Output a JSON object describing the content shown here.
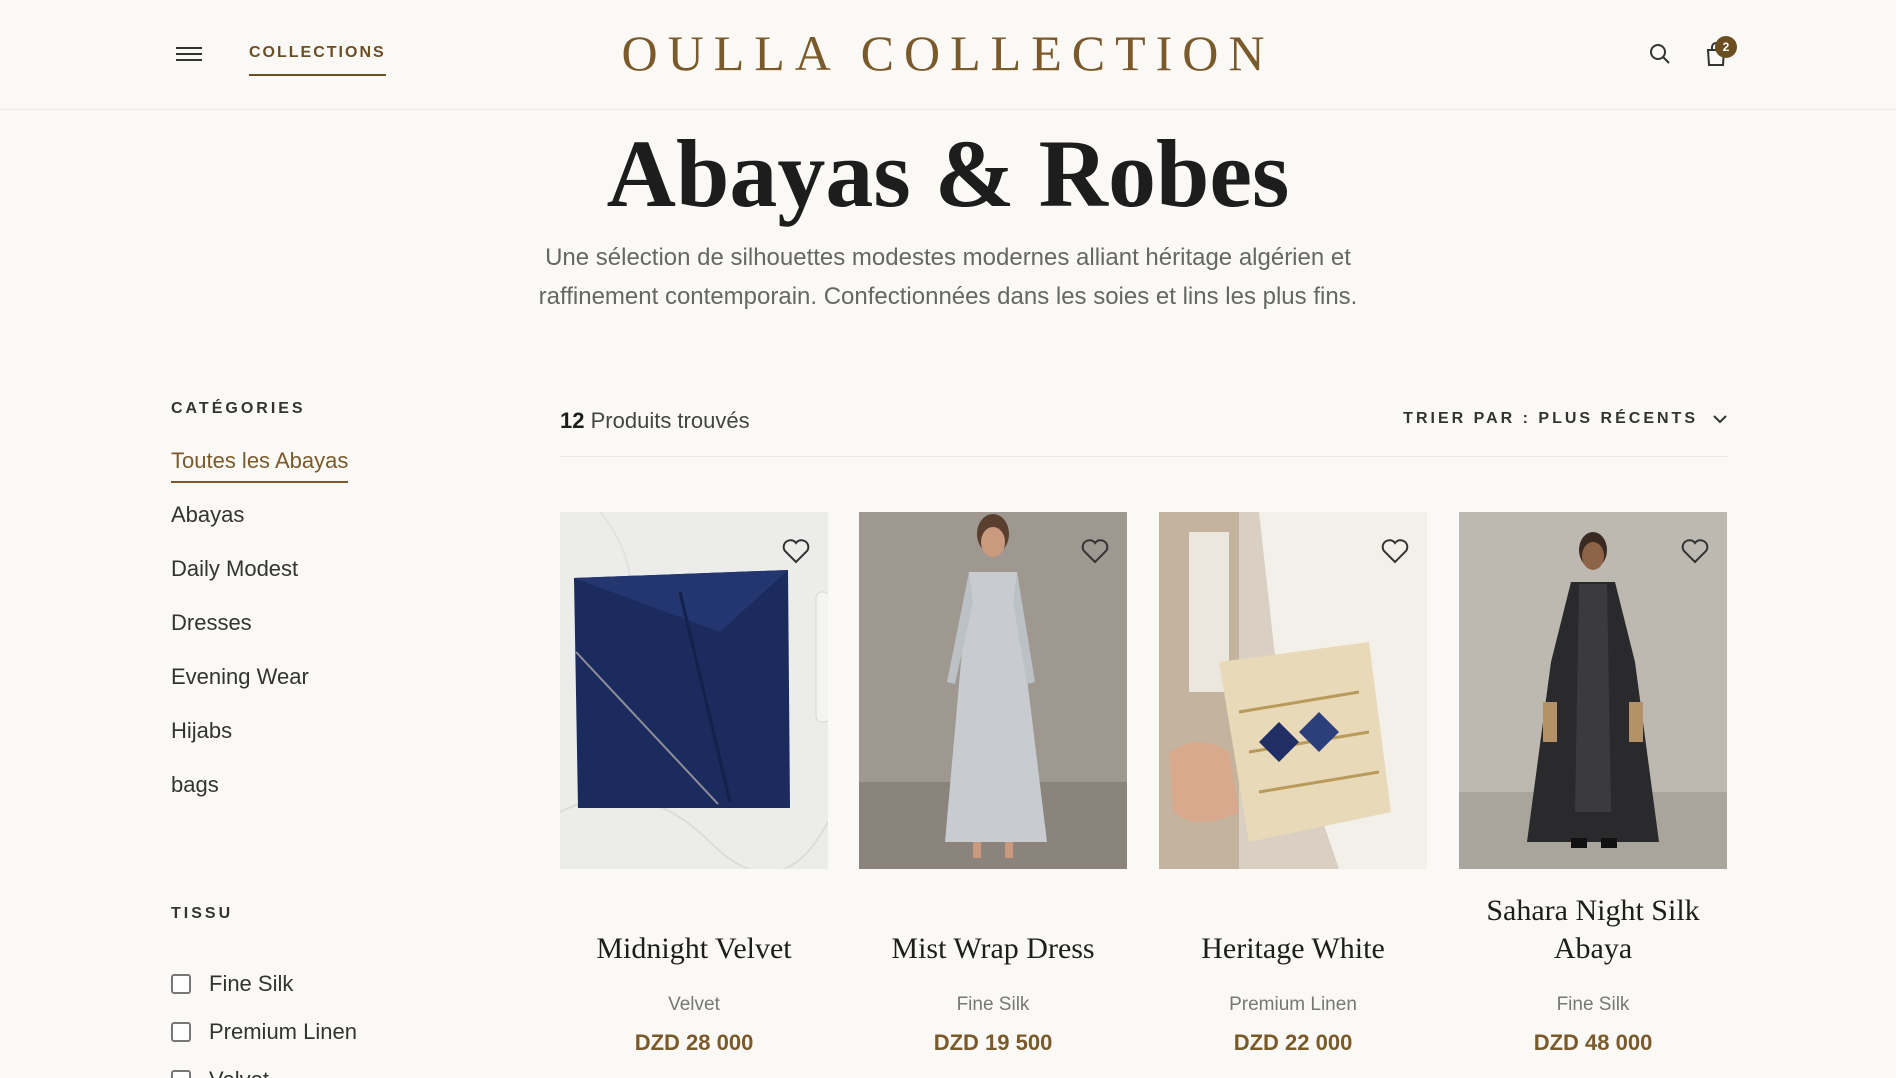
{
  "header": {
    "nav_label": "COLLECTIONS",
    "brand": "OULLA COLLECTION",
    "cart_count": "2"
  },
  "hero": {
    "title": "Abayas & Robes",
    "subtitle": "Une sélection de silhouettes modestes modernes alliant héritage algérien et raffinement contemporain. Confectionnées dans les soies et lins les plus fins."
  },
  "sidebar": {
    "categories_heading": "CATÉGORIES",
    "categories": [
      {
        "label": "Toutes les Abayas",
        "active": true
      },
      {
        "label": "Abayas",
        "active": false
      },
      {
        "label": "Daily Modest",
        "active": false
      },
      {
        "label": "Dresses",
        "active": false
      },
      {
        "label": "Evening Wear",
        "active": false
      },
      {
        "label": "Hijabs",
        "active": false
      },
      {
        "label": "bags",
        "active": false
      }
    ],
    "fabric_heading": "TISSU",
    "fabrics": [
      "Fine Silk",
      "Premium Linen",
      "Velvet"
    ]
  },
  "toolbar": {
    "count": "12",
    "count_label": "Produits trouvés",
    "sort_label": "TRIER PAR : PLUS RÉCENTS"
  },
  "products": [
    {
      "title": "Midnight Velvet",
      "fabric": "Velvet",
      "price": "DZD 28 000"
    },
    {
      "title": "Mist Wrap Dress",
      "fabric": "Fine Silk",
      "price": "DZD 19 500"
    },
    {
      "title": "Heritage White",
      "fabric": "Premium Linen",
      "price": "DZD 22 000"
    },
    {
      "title": "Sahara Night Silk Abaya",
      "fabric": "Fine Silk",
      "price": "DZD 48 000"
    }
  ],
  "colors": {
    "accent": "#7a5a2b",
    "background": "#faf9f6"
  }
}
